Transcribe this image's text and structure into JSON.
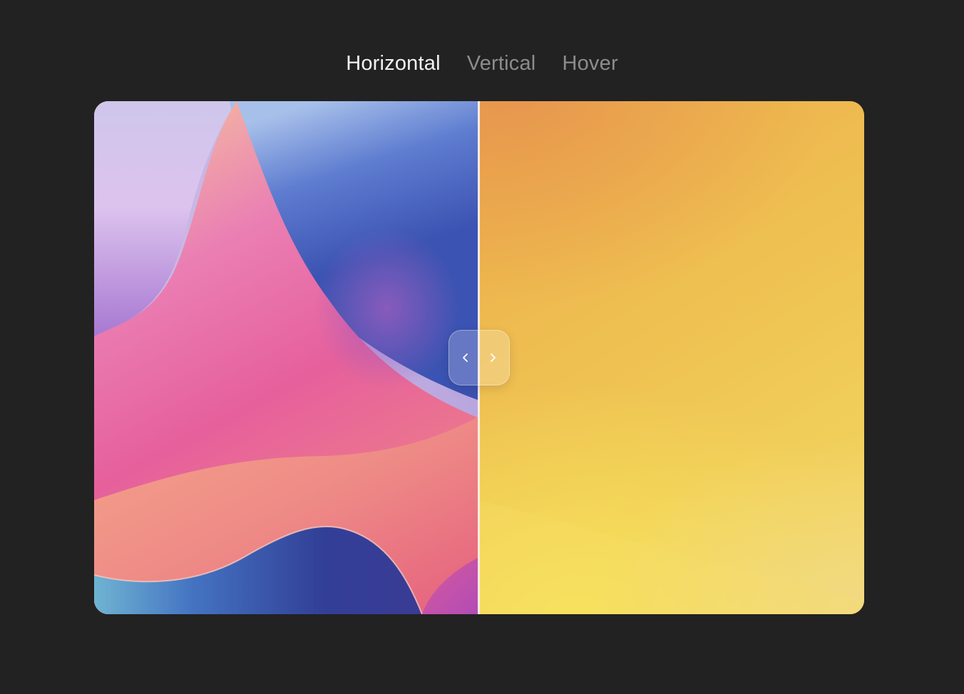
{
  "tabs": [
    {
      "label": "Horizontal",
      "active": true
    },
    {
      "label": "Vertical",
      "active": false
    },
    {
      "label": "Hover",
      "active": false
    }
  ],
  "comparison": {
    "mode": "horizontal",
    "split_position": 0.5,
    "before_image": "pink-purple-blue-gradient-waves",
    "after_image": "orange-yellow-gradient",
    "handle_icons": [
      "chevron-left-icon",
      "chevron-right-icon"
    ]
  },
  "colors": {
    "background": "#222222",
    "tab_active": "#f2f2f2",
    "tab_inactive": "#8c8c8c",
    "divider": "#fff4e6"
  }
}
